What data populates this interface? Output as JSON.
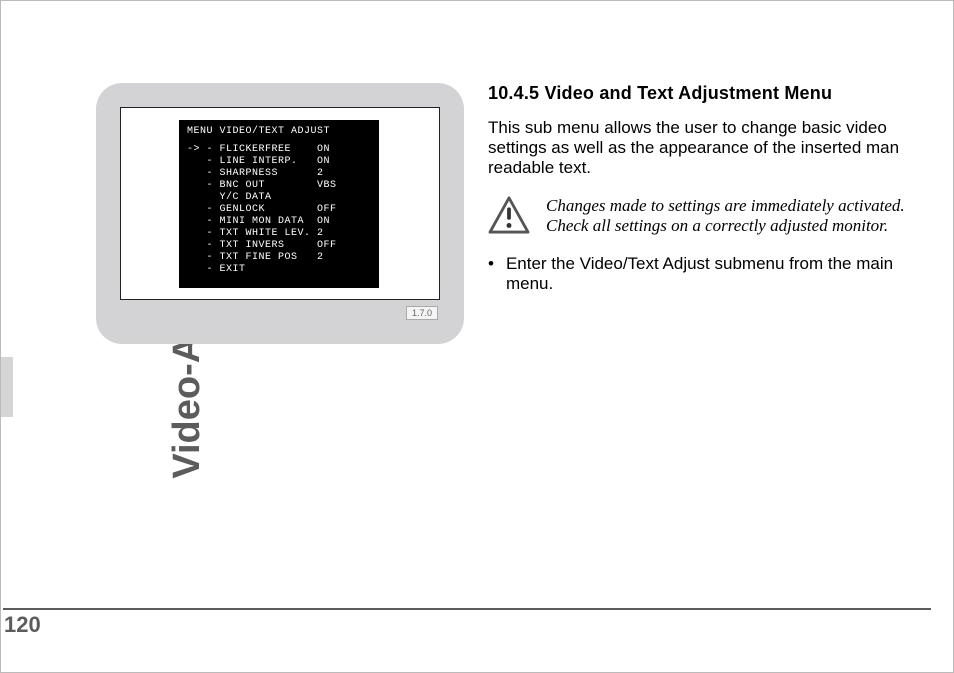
{
  "sidebar_label": "Video-Assist-System",
  "page_number": "120",
  "monitor": {
    "badge": "1.7.0",
    "title": "MENU VIDEO/TEXT ADJUST",
    "lines": [
      "-> - FLICKERFREE    ON",
      "   - LINE INTERP.   ON",
      "   - SHARPNESS      2",
      "   - BNC OUT        VBS",
      "     Y/C DATA",
      "   - GENLOCK        OFF",
      "   - MINI MON DATA  ON",
      "",
      "   - TXT WHITE LEV. 2",
      "   - TXT INVERS     OFF",
      "   - TXT FINE POS   2",
      "",
      "   - EXIT"
    ]
  },
  "section": {
    "heading": "10.4.5 Video and Text Adjustment Menu",
    "intro": "This sub menu allows the user to change basic video settings as well as the appearance of the inserted man readable text.",
    "note_line1": "Changes made to settings are immediately activated.",
    "note_line2": "Check all settings on a correctly adjusted monitor.",
    "bullet": "Enter the Video/Text Adjust submenu from the main menu."
  }
}
